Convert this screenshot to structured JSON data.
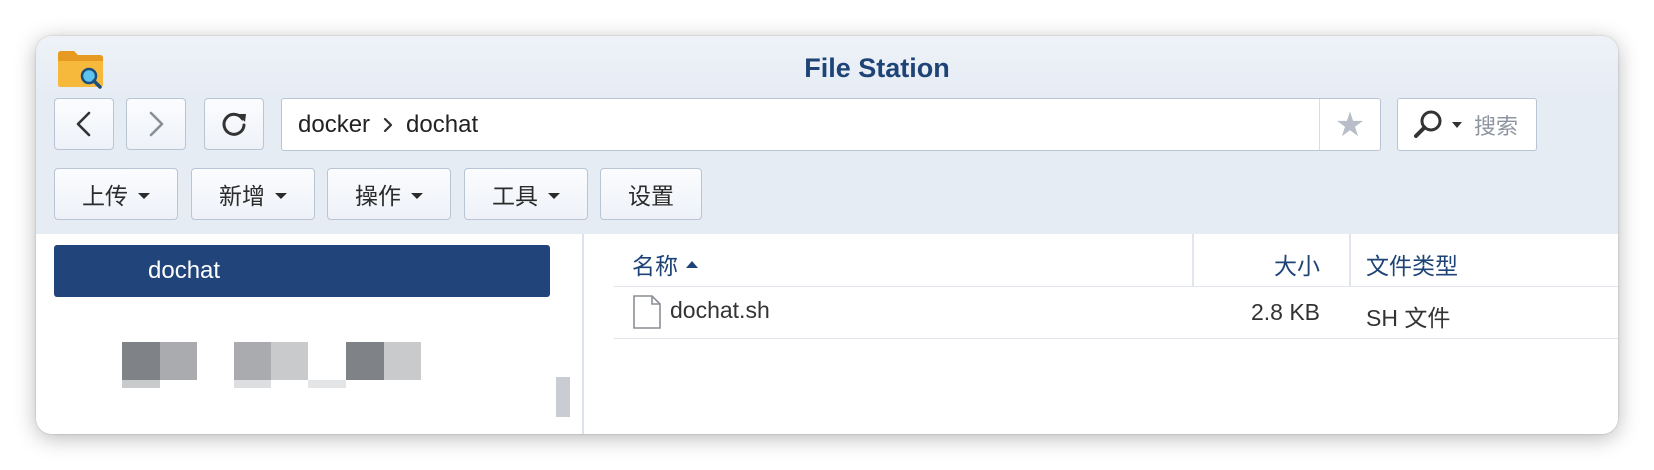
{
  "window": {
    "title": "File Station"
  },
  "nav": {
    "path": [
      "docker",
      "dochat"
    ],
    "search_placeholder": "搜索"
  },
  "toolbar": {
    "upload_label": "上传",
    "new_label": "新增",
    "action_label": "操作",
    "tools_label": "工具",
    "settings_label": "设置"
  },
  "tree": {
    "selected_folder": "dochat"
  },
  "file_list": {
    "columns": {
      "name": "名称",
      "size": "大小",
      "type": "文件类型"
    },
    "sort": "name-ascending",
    "rows": [
      {
        "name": "dochat.sh",
        "size": "2.8 KB",
        "type": "SH 文件",
        "icon": "file-icon"
      }
    ]
  },
  "colors": {
    "accent": "#21457b",
    "title": "#1e4477",
    "chrome_bg": "#e6ecf4"
  }
}
